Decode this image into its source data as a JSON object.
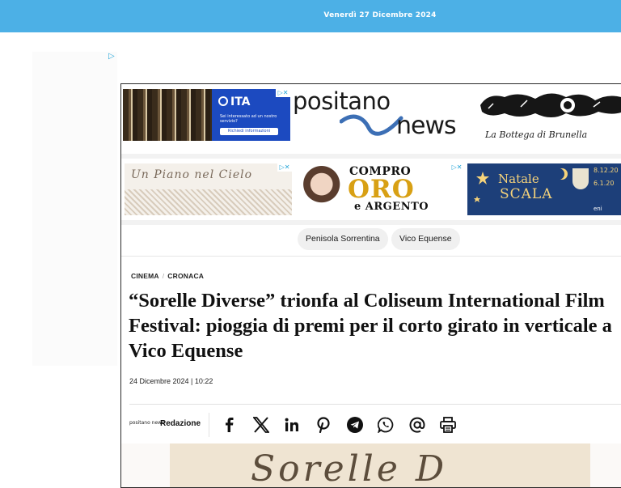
{
  "topbar": {
    "date": "Venerdì 27 Dicembre 2024"
  },
  "side_ad": {
    "adchoices": "▷"
  },
  "ads": {
    "ita": {
      "logo": "ITA",
      "text": "Sei interessato ad un nostro servizio?",
      "button": "Richiedi informazioni",
      "close": "▷✕"
    },
    "positano_logo": {
      "word1": "positano",
      "word2": "news"
    },
    "bottega": {
      "caption": "La Bottega di Brunella"
    },
    "piano": {
      "text": "Un Piano nel Cielo",
      "close": "▷✕"
    },
    "oro": {
      "line1": "COMPRO",
      "line2": "ORO",
      "line3": "e ARGENTO",
      "close": "▷✕"
    },
    "natale": {
      "line1": "Natale",
      "line2": "SCALA",
      "date1": "8.12.20",
      "date2": "6.1.20",
      "sponsor": "eni"
    }
  },
  "tags": [
    "Penisola Sorrentina",
    "Vico Equense"
  ],
  "article": {
    "categories": [
      "CINEMA",
      "CRONACA"
    ],
    "category_sep": "/",
    "title": "“Sorelle Diverse” trionfa al Coliseum International Film Festival: pioggia di premi per il corto girato in verticale a Vico Equense",
    "date": "24 Dicembre 2024 | 10:22",
    "author_logo": "positano news",
    "author": "Redazione"
  },
  "share_icons": [
    "facebook-icon",
    "x-icon",
    "linkedin-icon",
    "pinterest-icon",
    "telegram-icon",
    "whatsapp-icon",
    "email-icon",
    "print-icon"
  ],
  "hero_script": "Sorelle D"
}
